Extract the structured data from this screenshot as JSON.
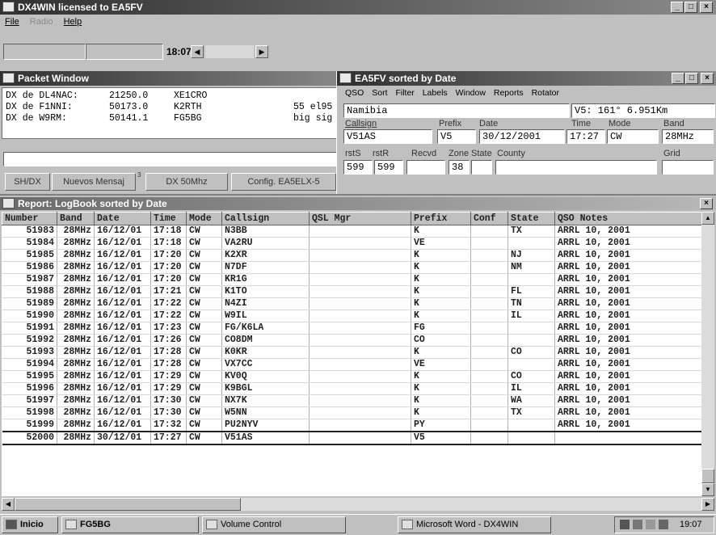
{
  "app": {
    "title": "DX4WIN licensed to EA5FV",
    "menu": [
      "File",
      "Radio",
      "Help"
    ],
    "clock": "18:07"
  },
  "packet": {
    "title": "Packet Window",
    "lines": [
      {
        "spotter": "DX de DL4NAC:",
        "freq": "21250.0",
        "call": "XE1CRO",
        "note": ""
      },
      {
        "spotter": "DX de F1NNI:",
        "freq": "50173.0",
        "call": "K2RTH",
        "note": "55 el95"
      },
      {
        "spotter": "DX de W9RM:",
        "freq": "50141.1",
        "call": "FG5BG",
        "note": "big sig"
      }
    ],
    "buttons": [
      "SH/DX",
      "Nuevos Mensaj",
      "DX 50Mhz",
      "Config. EA5ELX-5"
    ],
    "button_badge": "3"
  },
  "qso": {
    "title": "EA5FV sorted by Date",
    "menu": [
      "QSO",
      "Sort",
      "Filter",
      "Labels",
      "Window",
      "Reports",
      "Rotator"
    ],
    "country": "Namibia",
    "beam": "V5: 161° 6.951Km",
    "labels": {
      "callsign": "Callsign",
      "prefix": "Prefix",
      "date": "Date",
      "time": "Time",
      "mode": "Mode",
      "band": "Band",
      "rsts": "rstS",
      "rstr": "rstR",
      "recvd": "Recvd",
      "zone": "Zone",
      "state": "State",
      "county": "County",
      "grid": "Grid"
    },
    "values": {
      "callsign": "V51AS",
      "prefix": "V5",
      "date": "30/12/2001",
      "time": "17:27",
      "mode": "CW",
      "band": "28MHz",
      "rsts": "599",
      "rstr": "599",
      "recvd": "",
      "zone": "38",
      "state": "",
      "county": "",
      "grid": ""
    }
  },
  "report": {
    "title": "Report: LogBook sorted by Date",
    "columns": [
      "Number",
      "Band",
      "Date",
      "Time",
      "Mode",
      "Callsign",
      "QSL Mgr",
      "Prefix",
      "Conf",
      "State",
      "QSO Notes"
    ],
    "rows": [
      [
        "51983",
        "28MHz",
        "16/12/01",
        "17:18",
        "CW",
        "N3BB",
        "",
        "K",
        "",
        "TX",
        "ARRL 10, 2001"
      ],
      [
        "51984",
        "28MHz",
        "16/12/01",
        "17:18",
        "CW",
        "VA2RU",
        "",
        "VE",
        "",
        "",
        "ARRL 10, 2001"
      ],
      [
        "51985",
        "28MHz",
        "16/12/01",
        "17:20",
        "CW",
        "K2XR",
        "",
        "K",
        "",
        "NJ",
        "ARRL 10, 2001"
      ],
      [
        "51986",
        "28MHz",
        "16/12/01",
        "17:20",
        "CW",
        "N7DF",
        "",
        "K",
        "",
        "NM",
        "ARRL 10, 2001"
      ],
      [
        "51987",
        "28MHz",
        "16/12/01",
        "17:20",
        "CW",
        "KR1G",
        "",
        "K",
        "",
        "",
        "ARRL 10, 2001"
      ],
      [
        "51988",
        "28MHz",
        "16/12/01",
        "17:21",
        "CW",
        "K1TO",
        "",
        "K",
        "",
        "FL",
        "ARRL 10, 2001"
      ],
      [
        "51989",
        "28MHz",
        "16/12/01",
        "17:22",
        "CW",
        "N4ZI",
        "",
        "K",
        "",
        "TN",
        "ARRL 10, 2001"
      ],
      [
        "51990",
        "28MHz",
        "16/12/01",
        "17:22",
        "CW",
        "W9IL",
        "",
        "K",
        "",
        "IL",
        "ARRL 10, 2001"
      ],
      [
        "51991",
        "28MHz",
        "16/12/01",
        "17:23",
        "CW",
        "FG/K6LA",
        "",
        "FG",
        "",
        "",
        "ARRL 10, 2001"
      ],
      [
        "51992",
        "28MHz",
        "16/12/01",
        "17:26",
        "CW",
        "CO8DM",
        "",
        "CO",
        "",
        "",
        "ARRL 10, 2001"
      ],
      [
        "51993",
        "28MHz",
        "16/12/01",
        "17:28",
        "CW",
        "K0KR",
        "",
        "K",
        "",
        "CO",
        "ARRL 10, 2001"
      ],
      [
        "51994",
        "28MHz",
        "16/12/01",
        "17:28",
        "CW",
        "VX7CC",
        "",
        "VE",
        "",
        "",
        "ARRL 10, 2001"
      ],
      [
        "51995",
        "28MHz",
        "16/12/01",
        "17:29",
        "CW",
        "KV0Q",
        "",
        "K",
        "",
        "CO",
        "ARRL 10, 2001"
      ],
      [
        "51996",
        "28MHz",
        "16/12/01",
        "17:29",
        "CW",
        "K9BGL",
        "",
        "K",
        "",
        "IL",
        "ARRL 10, 2001"
      ],
      [
        "51997",
        "28MHz",
        "16/12/01",
        "17:30",
        "CW",
        "NX7K",
        "",
        "K",
        "",
        "WA",
        "ARRL 10, 2001"
      ],
      [
        "51998",
        "28MHz",
        "16/12/01",
        "17:30",
        "CW",
        "W5NN",
        "",
        "K",
        "",
        "TX",
        "ARRL 10, 2001"
      ],
      [
        "51999",
        "28MHz",
        "16/12/01",
        "17:32",
        "CW",
        "PU2NYV",
        "",
        "PY",
        "",
        "",
        "ARRL 10, 2001"
      ],
      [
        "52000",
        "28MHz",
        "30/12/01",
        "17:27",
        "CW",
        "V51AS",
        "",
        "V5",
        "",
        "",
        ""
      ]
    ],
    "selected_index": 17
  },
  "taskbar": {
    "start": "Inicio",
    "tasks": [
      "FG5BG",
      "Volume Control",
      "Microsoft Word - DX4WIN"
    ],
    "time": "19:07"
  }
}
